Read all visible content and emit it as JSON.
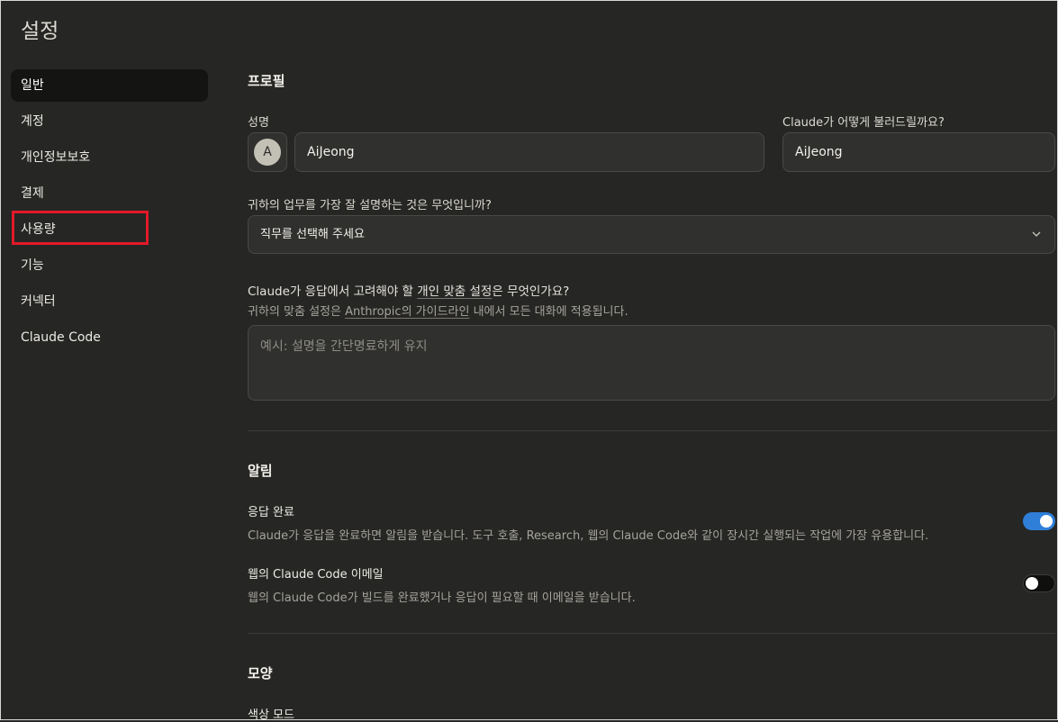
{
  "page_title": "설정",
  "sidebar": {
    "items": [
      {
        "label": "일반"
      },
      {
        "label": "계정"
      },
      {
        "label": "개인정보보호"
      },
      {
        "label": "결제"
      },
      {
        "label": "사용량"
      },
      {
        "label": "기능"
      },
      {
        "label": "커넥터"
      },
      {
        "label": "Claude Code"
      }
    ]
  },
  "profile": {
    "section_title": "프로필",
    "name_label": "성명",
    "avatar_initial": "A",
    "name_value": "AiJeong",
    "nickname_label": "Claude가 어떻게 불러드릴까요?",
    "nickname_value": "AiJeong",
    "role_label": "귀하의 업무를 가장 잘 설명하는 것은 무엇입니까?",
    "role_select": "직무를 선택해 주세요",
    "pref_q_pre": "Claude가 응답에서 고려해야 할 ",
    "pref_q_link": "개인 맞춤 설정",
    "pref_q_post": "은 무엇인가요?",
    "pref_sub_pre": "귀하의 맞춤 설정은 ",
    "pref_sub_link": "Anthropic의 가이드라인",
    "pref_sub_post": " 내에서 모든 대화에 적용됩니다.",
    "pref_placeholder": "예시: 설명을 간단명료하게 유지"
  },
  "notifications": {
    "section_title": "알림",
    "response_title": "응답 완료",
    "response_desc": "Claude가 응답을 완료하면 알림을 받습니다. 도구 호출, Research, 웹의 Claude Code와 같이 장시간 실행되는 작업에 가장 유용합니다.",
    "response_enabled": true,
    "email_title": "웹의 Claude Code 이메일",
    "email_desc": "웹의 Claude Code가 빌드를 완료했거나 응답이 필요할 때 이메일을 받습니다.",
    "email_enabled": false
  },
  "appearance": {
    "section_title": "모양",
    "color_mode_label": "색상 모드"
  },
  "colors": {
    "accent": "#2f7fd8",
    "highlight_box": "#e3192a"
  }
}
